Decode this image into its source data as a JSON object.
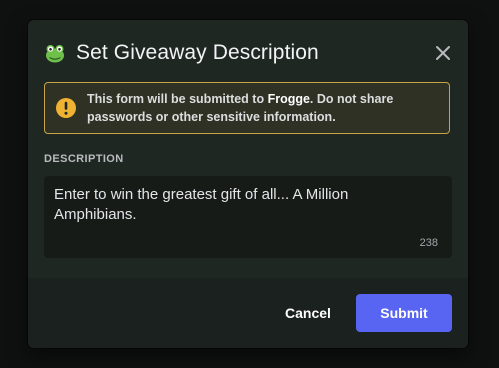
{
  "modal": {
    "title": "Set Giveaway Description",
    "title_icon": "frog-icon",
    "close_icon": "close-icon"
  },
  "notice": {
    "icon": "warning-icon",
    "text_prefix": "This form will be submitted to ",
    "brand": "Frogge",
    "text_suffix": ". Do not share passwords or other sensitive information.",
    "border_color": "#c9a24a"
  },
  "field": {
    "label": "DESCRIPTION",
    "value": "Enter to win the greatest gift of all... A Million Amphibians.",
    "remaining_chars": "238"
  },
  "buttons": {
    "cancel_label": "Cancel",
    "submit_label": "Submit",
    "submit_color": "#5865f2"
  }
}
